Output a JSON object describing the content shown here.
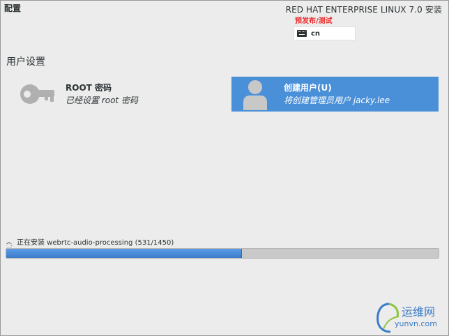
{
  "header": {
    "title": "配置",
    "product_name": "RED HAT ENTERPRISE LINUX 7.0 安装",
    "prerelease": "预发布/测试",
    "keyboard_layout": "cn"
  },
  "user_settings": {
    "section_title": "用户设置",
    "spokes": [
      {
        "title": "ROOT 密码",
        "status": "已经设置 root 密码",
        "icon": "key-icon",
        "selected": false
      },
      {
        "title": "创建用户(U)",
        "status": "将创建管理员用户 jacky.lee",
        "icon": "user-icon",
        "selected": true
      }
    ]
  },
  "progress": {
    "label": "正在安装 webrtc-audio-processing (531/1450)",
    "fraction": 0.545,
    "icon": "spinner-icon"
  },
  "watermark": {
    "name": "运维网",
    "url": "yunvn.com"
  },
  "colors": {
    "background": "#ececec",
    "accent": "#4a90d9",
    "prerelease": "#ef2929",
    "progress": "#3b7ac9"
  }
}
